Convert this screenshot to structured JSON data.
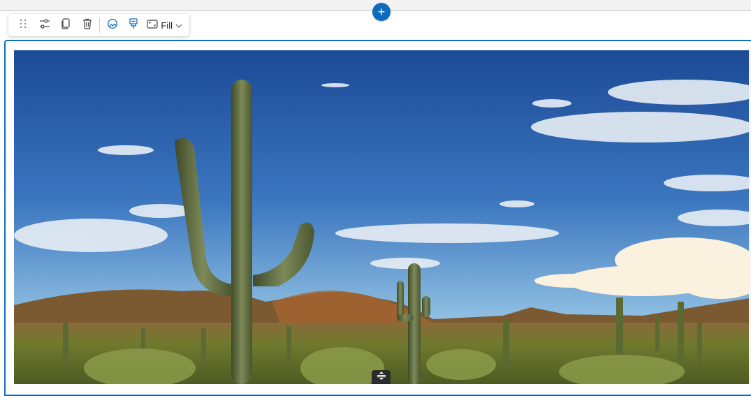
{
  "toolbar": {
    "icons": [
      "drag-handle-icon",
      "settings-sliders-icon",
      "copy-icon",
      "delete-icon",
      "alt-text-icon",
      "focal-point-icon",
      "fill-mode-icon",
      "chevron-down-icon"
    ],
    "fill_label": "Fill"
  },
  "add_button": {
    "glyph": "+",
    "icon": "plus-icon"
  },
  "colors": {
    "accent": "#0f6cbd",
    "sky_top": "#1f4f9e",
    "sky_bottom": "#9cc6e6",
    "ground": "#6b6a2e"
  },
  "image": {
    "subject": "desert-saguaro-landscape"
  }
}
